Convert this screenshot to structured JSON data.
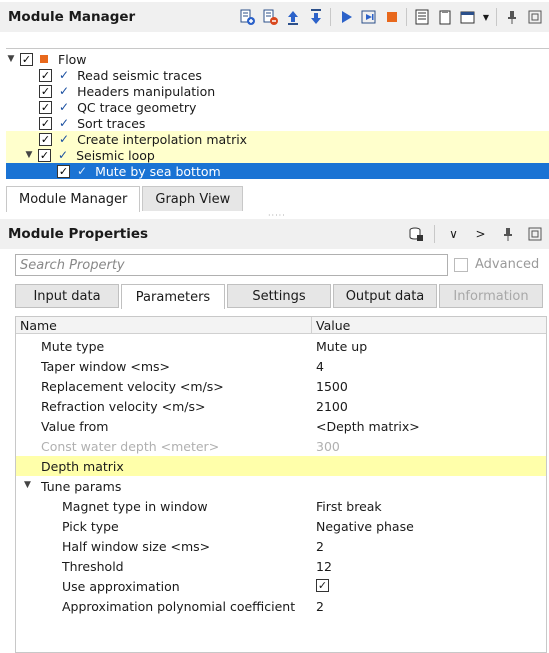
{
  "module_manager": {
    "title": "Module Manager",
    "toolbar": [
      "add-module-icon",
      "remove-module-icon",
      "move-up-icon",
      "move-down-icon",
      "run-icon",
      "run-step-icon",
      "stop-icon",
      "log-icon",
      "clipboard-icon",
      "window-menu-icon",
      "pin-icon",
      "float-icon"
    ]
  },
  "flow": {
    "root_label": "Flow",
    "items": [
      {
        "label": "Read seismic traces",
        "checked": true,
        "status": "ok"
      },
      {
        "label": "Headers manipulation",
        "checked": true,
        "status": "ok"
      },
      {
        "label": "QC trace geometry",
        "checked": true,
        "status": "ok"
      },
      {
        "label": "Sort traces",
        "checked": true,
        "status": "ok"
      },
      {
        "label": "Create interpolation matrix",
        "checked": true,
        "status": "ok",
        "highlighted": true
      },
      {
        "label": "Seismic loop",
        "checked": true,
        "status": "ok",
        "highlighted": true,
        "expanded": true
      },
      {
        "label": "Mute by sea bottom",
        "checked": true,
        "status": "ok",
        "selected": true
      }
    ]
  },
  "view_tabs": [
    {
      "label": "Module Manager",
      "active": true
    },
    {
      "label": "Graph View",
      "active": false
    }
  ],
  "module_properties": {
    "title": "Module Properties",
    "search_placeholder": "Search Property",
    "advanced_label": "Advanced",
    "tabs": [
      {
        "label": "Input data",
        "active": false,
        "enabled": true
      },
      {
        "label": "Parameters",
        "active": true,
        "enabled": true
      },
      {
        "label": "Settings",
        "active": false,
        "enabled": true
      },
      {
        "label": "Output data",
        "active": false,
        "enabled": true
      },
      {
        "label": "Information",
        "active": false,
        "enabled": false
      }
    ],
    "columns": {
      "name": "Name",
      "value": "Value"
    },
    "rows": [
      {
        "name": "Mute type",
        "value": "Mute up"
      },
      {
        "name": "Taper window <ms>",
        "value": "4"
      },
      {
        "name": "Replacement velocity <m/s>",
        "value": "1500"
      },
      {
        "name": "Refraction velocity <m/s>",
        "value": "2100"
      },
      {
        "name": "Value from",
        "value": "<Depth matrix>"
      },
      {
        "name": "Const water depth <meter>",
        "value": "300",
        "disabled": true
      },
      {
        "name": "Depth matrix",
        "value": "",
        "highlighted": true
      },
      {
        "name": "Tune params",
        "value": "",
        "group": true
      },
      {
        "name": "Magnet type in window",
        "value": "First break",
        "child": true
      },
      {
        "name": "Pick type",
        "value": "Negative phase",
        "child": true
      },
      {
        "name": "Half window size <ms>",
        "value": "2",
        "child": true
      },
      {
        "name": "Threshold",
        "value": "12",
        "child": true
      },
      {
        "name": "Use approximation",
        "value": "",
        "checkbox": true,
        "checked": true,
        "child": true
      },
      {
        "name": "Approximation polynomial coefficient",
        "value": "2",
        "child": true
      }
    ]
  },
  "colors": {
    "selection": "#1a73d4",
    "highlight": "#ffffcc",
    "row_highlight": "#ffffaa",
    "accent_orange": "#e8681c"
  }
}
